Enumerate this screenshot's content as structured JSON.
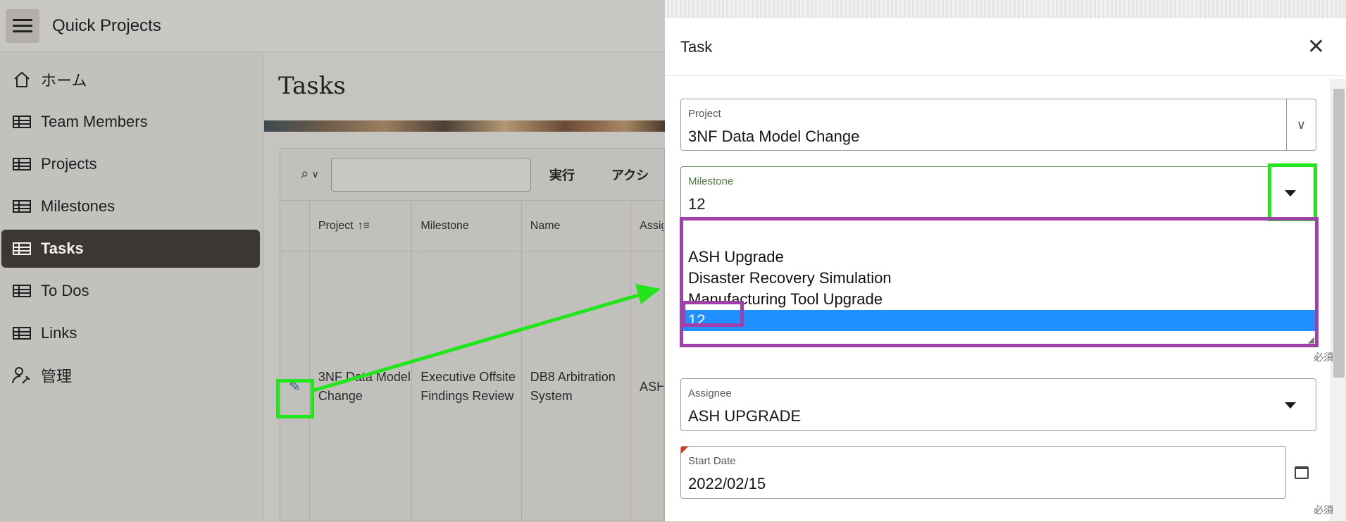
{
  "app": {
    "title": "Quick Projects"
  },
  "sidebar": {
    "items": [
      {
        "label": "ホーム",
        "icon": "home-icon"
      },
      {
        "label": "Team Members",
        "icon": "table-icon"
      },
      {
        "label": "Projects",
        "icon": "table-icon"
      },
      {
        "label": "Milestones",
        "icon": "table-pointer-icon"
      },
      {
        "label": "Tasks",
        "icon": "table-icon",
        "active": true
      },
      {
        "label": "To Dos",
        "icon": "table-icon"
      },
      {
        "label": "Links",
        "icon": "table-icon"
      },
      {
        "label": "管理",
        "icon": "user-wrench-icon"
      }
    ]
  },
  "page": {
    "title": "Tasks"
  },
  "report": {
    "go_label": "実行",
    "actions_label": "アクシ",
    "columns": [
      "Project",
      "Milestone",
      "Name",
      "Assig"
    ],
    "row": {
      "project": "3NF Data Model Change",
      "milestone": "Executive Offsite Findings Review",
      "name": "DB8 Arbitration System",
      "assignee": "ASH"
    }
  },
  "dialog": {
    "title": "Task",
    "project": {
      "label": "Project",
      "value": "3NF Data Model Change"
    },
    "milestone": {
      "label": "Milestone",
      "value": "12",
      "options": [
        "",
        "ASH Upgrade",
        "Disaster Recovery Simulation",
        "Manufacturing Tool Upgrade",
        "12"
      ],
      "selected": "12",
      "required_text": "必須"
    },
    "assignee": {
      "label": "Assignee",
      "value": "ASH UPGRADE"
    },
    "start_date": {
      "label": "Start Date",
      "value": "2022/02/15",
      "required_text": "必須"
    }
  },
  "colors": {
    "highlight_green": "#22e61b",
    "highlight_purple": "#a040a8",
    "select_blue": "#1e90ff",
    "nav_active": "#3b3733"
  }
}
